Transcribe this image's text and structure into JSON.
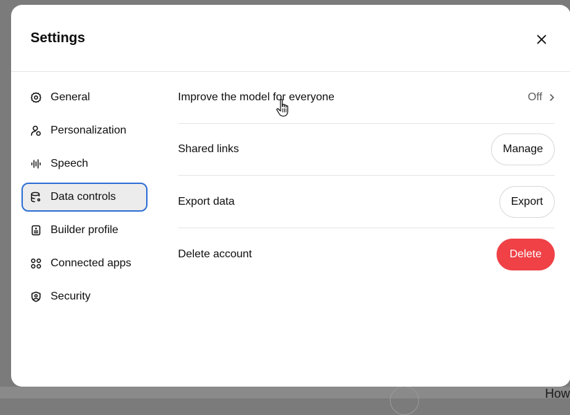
{
  "dialog": {
    "title": "Settings"
  },
  "sidebar": {
    "items": [
      {
        "label": "General",
        "icon": "gear-icon"
      },
      {
        "label": "Personalization",
        "icon": "personalization-icon"
      },
      {
        "label": "Speech",
        "icon": "waveform-icon"
      },
      {
        "label": "Data controls",
        "icon": "database-icon",
        "active": true
      },
      {
        "label": "Builder profile",
        "icon": "profile-card-icon"
      },
      {
        "label": "Connected apps",
        "icon": "apps-grid-icon"
      },
      {
        "label": "Security",
        "icon": "shield-icon"
      }
    ]
  },
  "data_controls": {
    "rows": [
      {
        "label": "Improve the model for everyone",
        "value": "Off"
      },
      {
        "label": "Shared links",
        "button": "Manage"
      },
      {
        "label": "Export data",
        "button": "Export"
      },
      {
        "label": "Delete account",
        "button": "Delete"
      }
    ]
  },
  "background": {
    "partial_text": "How"
  },
  "colors": {
    "accent_outline": "#2f6fd6",
    "danger": "#ef4146",
    "overlay": "#7b7b7b"
  }
}
